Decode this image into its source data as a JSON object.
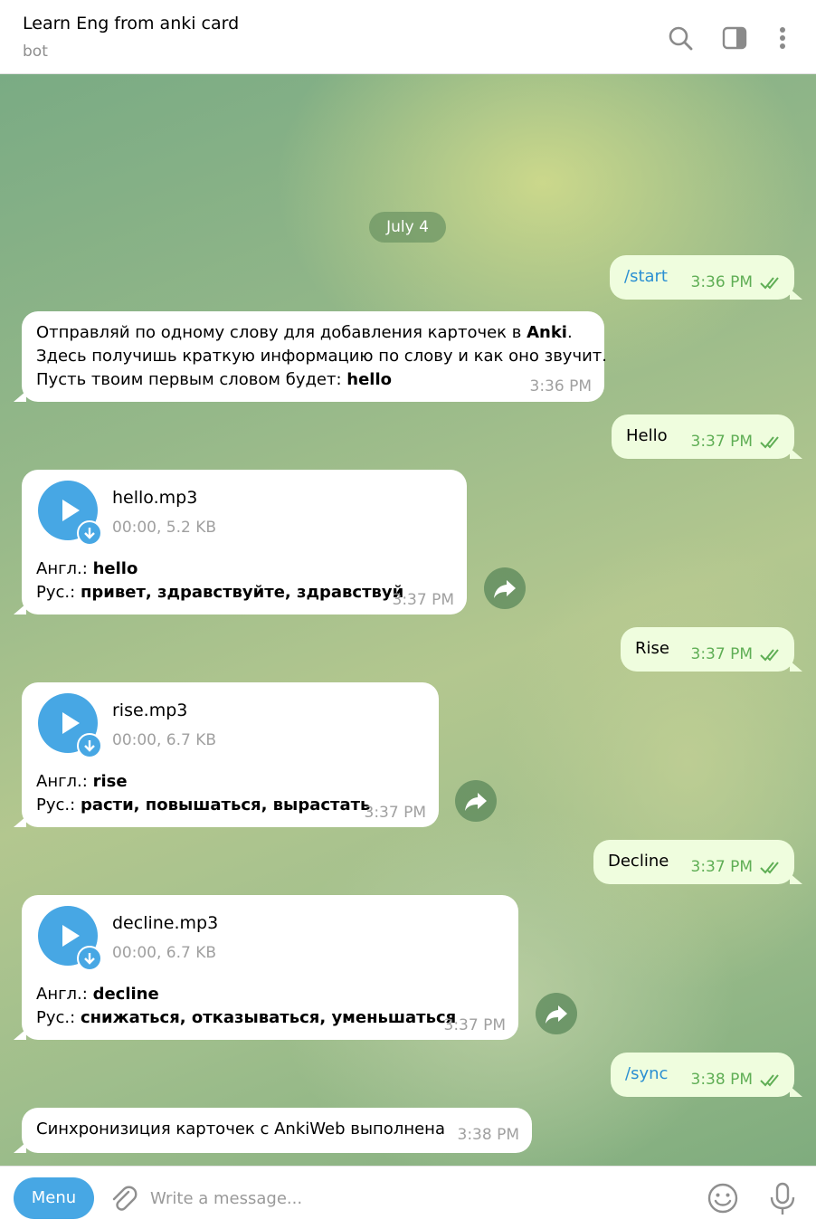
{
  "header": {
    "title": "Learn Eng from anki card",
    "subtitle": "bot",
    "icons": [
      "search-icon",
      "sidebar-toggle-icon",
      "more-vertical-icon"
    ]
  },
  "chat": {
    "date": "July 4",
    "messages": {
      "m1": {
        "direction": "out",
        "text": "/start",
        "time": "3:36 PM"
      },
      "m2": {
        "direction": "in",
        "line1_prefix": "Отправляй по одному слову для добавления карточек в ",
        "line1_bold": "Anki",
        "line1_suffix": ".",
        "line2": "Здесь получишь краткую информацию по слову и как оно звучит.",
        "line3_prefix": "Пусть твоим первым словом будет: ",
        "line3_bold": "hello",
        "time": "3:36 PM"
      },
      "m3": {
        "direction": "out",
        "text": "Hello",
        "time": "3:37 PM"
      },
      "m4": {
        "direction": "in",
        "file": "hello.mp3",
        "meta": "00:00, 5.2 KB",
        "en_label": "Англ.:",
        "en": "hello",
        "ru_label": "Рус.:",
        "ru": "привет, здравствуйте, здравствуй",
        "time": "3:37 PM"
      },
      "m5": {
        "direction": "out",
        "text": "Rise",
        "time": "3:37 PM"
      },
      "m6": {
        "direction": "in",
        "file": "rise.mp3",
        "meta": "00:00, 6.7 KB",
        "en_label": "Англ.:",
        "en": "rise",
        "ru_label": "Рус.:",
        "ru": "расти, повышаться, вырастать",
        "time": "3:37 PM"
      },
      "m7": {
        "direction": "out",
        "text": "Decline",
        "time": "3:37 PM"
      },
      "m8": {
        "direction": "in",
        "file": "decline.mp3",
        "meta": "00:00, 6.7 KB",
        "en_label": "Англ.:",
        "en": "decline",
        "ru_label": "Рус.:",
        "ru": "снижаться, отказываться, уменьшаться",
        "time": "3:37 PM"
      },
      "m9": {
        "direction": "out",
        "text": "/sync",
        "time": "3:38 PM"
      },
      "m10": {
        "direction": "in",
        "text": "Синхронизиция карточек с AnkiWeb выполнена",
        "time": "3:38 PM"
      }
    }
  },
  "composer": {
    "menu_label": "Menu",
    "placeholder": "Write a message...",
    "icons": [
      "attach-icon",
      "emoji-icon",
      "microphone-icon"
    ]
  },
  "colors": {
    "accent": "#47a7e4",
    "outgoing_bubble": "#effdde",
    "outgoing_time": "#5fae55",
    "command_link": "#2b8fd2"
  }
}
